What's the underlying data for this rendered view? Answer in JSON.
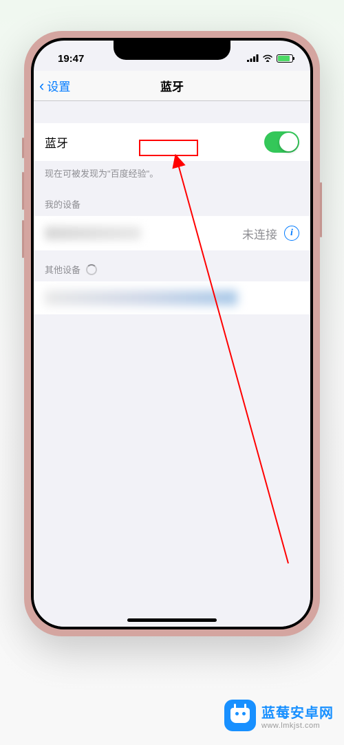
{
  "statusBar": {
    "time": "19:47"
  },
  "navBar": {
    "backLabel": "设置",
    "title": "蓝牙"
  },
  "bluetooth": {
    "label": "蓝牙",
    "enabled": true,
    "discoverableText": "现在可被发现为\"百度经验\"。"
  },
  "myDevices": {
    "header": "我的设备",
    "status": "未连接"
  },
  "otherDevices": {
    "header": "其他设备"
  },
  "watermark": {
    "title": "蓝莓安卓网",
    "url": "www.lmkjst.com"
  }
}
